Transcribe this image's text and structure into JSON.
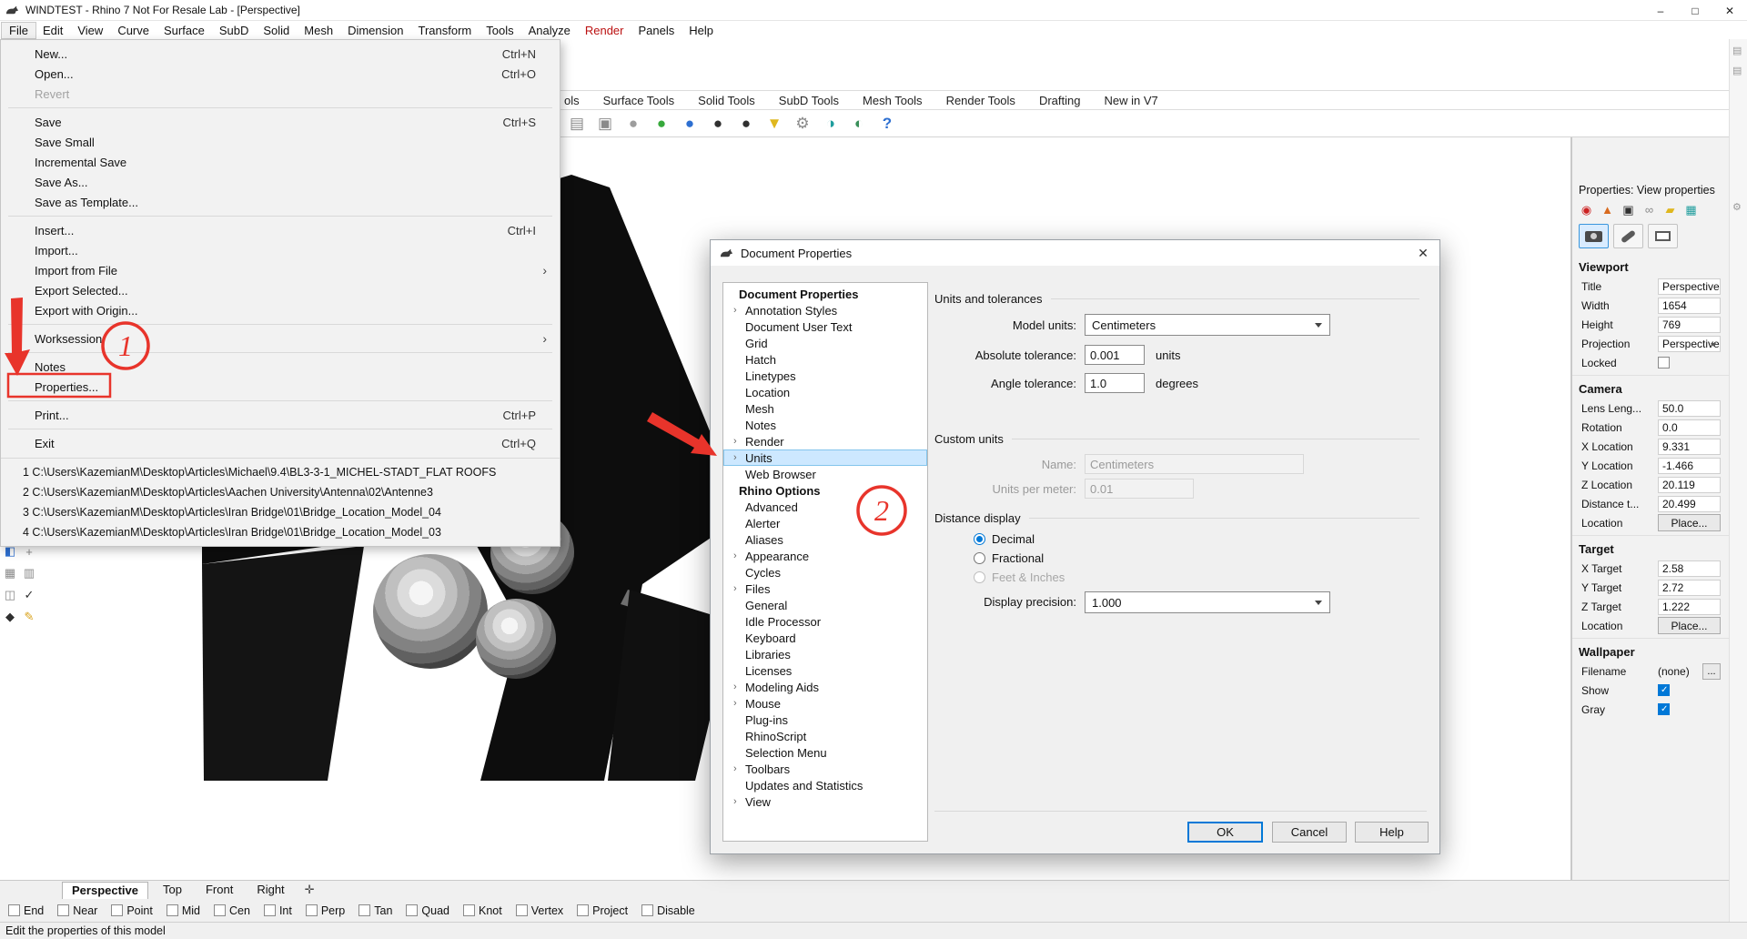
{
  "titlebar": {
    "title": "WINDTEST - Rhino 7 Not For Resale Lab - [Perspective]",
    "controls": {
      "minimize": "–",
      "maximize": "□",
      "close": "✕"
    }
  },
  "menubar": {
    "items": [
      {
        "label": "File",
        "active": true
      },
      {
        "label": "Edit"
      },
      {
        "label": "View"
      },
      {
        "label": "Curve"
      },
      {
        "label": "Surface"
      },
      {
        "label": "SubD"
      },
      {
        "label": "Solid"
      },
      {
        "label": "Mesh"
      },
      {
        "label": "Dimension"
      },
      {
        "label": "Transform"
      },
      {
        "label": "Tools"
      },
      {
        "label": "Analyze"
      },
      {
        "label": "Render",
        "red": true
      },
      {
        "label": "Panels"
      },
      {
        "label": "Help"
      }
    ]
  },
  "file_menu": {
    "items": [
      {
        "label": "New...",
        "shortcut": "Ctrl+N"
      },
      {
        "label": "Open...",
        "shortcut": "Ctrl+O"
      },
      {
        "label": "Revert",
        "disabled": true
      },
      {
        "label": "Save",
        "shortcut": "Ctrl+S",
        "sep_before": true
      },
      {
        "label": "Save Small"
      },
      {
        "label": "Incremental Save"
      },
      {
        "label": "Save As..."
      },
      {
        "label": "Save as Template..."
      },
      {
        "label": "Insert...",
        "shortcut": "Ctrl+I",
        "sep_before": true
      },
      {
        "label": "Import..."
      },
      {
        "label": "Import from File",
        "arrow": "›"
      },
      {
        "label": "Export Selected..."
      },
      {
        "label": "Export with Origin..."
      },
      {
        "label": "Worksession",
        "arrow": "›",
        "sep_before": true
      },
      {
        "label": "Notes",
        "sep_before": true
      },
      {
        "label": "Properties..."
      },
      {
        "label": "Print...",
        "shortcut": "Ctrl+P",
        "sep_before": true
      },
      {
        "label": "Exit",
        "shortcut": "Ctrl+Q",
        "sep_before": true
      }
    ],
    "recent": [
      {
        "label": "1 C:\\Users\\KazemianM\\Desktop\\Articles\\Michael\\9.4\\BL3-3-1_MICHEL-STADT_FLAT ROOFS"
      },
      {
        "label": "2 C:\\Users\\KazemianM\\Desktop\\Articles\\Aachen University\\Antenna\\02\\Antenne3"
      },
      {
        "label": "3 C:\\Users\\KazemianM\\Desktop\\Articles\\Iran Bridge\\01\\Bridge_Location_Model_04"
      },
      {
        "label": "4 C:\\Users\\KazemianM\\Desktop\\Articles\\Iran Bridge\\01\\Bridge_Location_Model_03"
      }
    ]
  },
  "toolbar": {
    "tabs": [
      "ols",
      "Surface Tools",
      "Solid Tools",
      "SubD Tools",
      "Mesh Tools",
      "Render Tools",
      "Drafting",
      "New in V7"
    ],
    "icons": [
      {
        "name": "panel-icon",
        "glyph": "▤",
        "cls": "ic-gray"
      },
      {
        "name": "lock-icon",
        "glyph": "▣",
        "cls": "ic-gray"
      },
      {
        "name": "shaded-sphere-icon",
        "glyph": "●",
        "cls": "ic-midgray"
      },
      {
        "name": "rendered-sphere-icon",
        "glyph": "●",
        "cls": "ic-green"
      },
      {
        "name": "render-icon",
        "glyph": "●",
        "cls": "ic-blue"
      },
      {
        "name": "render-window-icon",
        "glyph": "●",
        "cls": "ic-dark"
      },
      {
        "name": "render-preview-icon",
        "glyph": "●",
        "cls": "ic-dark"
      },
      {
        "name": "filter-icon",
        "glyph": "▼",
        "cls": "ic-yellow"
      },
      {
        "name": "gear-search-icon",
        "glyph": "⚙",
        "cls": "ic-gray"
      },
      {
        "name": "texture-icon",
        "glyph": "◑",
        "cls": "ic-teal"
      },
      {
        "name": "globe-icon",
        "glyph": "◐",
        "cls": "ic-globe"
      },
      {
        "name": "help-icon",
        "glyph": "?",
        "cls": "ic-help"
      }
    ]
  },
  "side_toolbar": {
    "icons": [
      {
        "name": "viewport-layout-icon",
        "glyph": "◧",
        "cls": "ic-blue"
      },
      {
        "name": "osnap-icon",
        "glyph": "+",
        "cls": "ic-gray"
      },
      {
        "name": "grid-icon",
        "glyph": "▦",
        "cls": "ic-gray"
      },
      {
        "name": "layers-icon",
        "glyph": "▥",
        "cls": "ic-gray"
      },
      {
        "name": "panels-icon",
        "glyph": "◫",
        "cls": "ic-gray"
      },
      {
        "name": "check-icon",
        "glyph": "✓",
        "cls": "ic-dark"
      },
      {
        "name": "gem-icon",
        "glyph": "◆",
        "cls": "ic-dark"
      },
      {
        "name": "pencil-icon",
        "glyph": "✎",
        "cls": "ic-yellow2"
      }
    ]
  },
  "dialog": {
    "title": "Document Properties",
    "close_glyph": "✕",
    "tree": [
      {
        "label": "Document Properties",
        "bold": true
      },
      {
        "label": "Annotation Styles",
        "chev": "›"
      },
      {
        "label": "Document User Text"
      },
      {
        "label": "Grid"
      },
      {
        "label": "Hatch"
      },
      {
        "label": "Linetypes"
      },
      {
        "label": "Location"
      },
      {
        "label": "Mesh"
      },
      {
        "label": "Notes"
      },
      {
        "label": "Render",
        "chev": "›"
      },
      {
        "label": "Units",
        "chev": "›",
        "selected": true
      },
      {
        "label": "Web Browser"
      },
      {
        "label": "Rhino Options",
        "bold": true
      },
      {
        "label": "Advanced"
      },
      {
        "label": "Alerter"
      },
      {
        "label": "Aliases"
      },
      {
        "label": "Appearance",
        "chev": "›"
      },
      {
        "label": "Cycles"
      },
      {
        "label": "Files",
        "chev": "›"
      },
      {
        "label": "General"
      },
      {
        "label": "Idle Processor"
      },
      {
        "label": "Keyboard"
      },
      {
        "label": "Libraries"
      },
      {
        "label": "Licenses"
      },
      {
        "label": "Modeling Aids",
        "chev": "›"
      },
      {
        "label": "Mouse",
        "chev": "›"
      },
      {
        "label": "Plug-ins"
      },
      {
        "label": "RhinoScript"
      },
      {
        "label": "Selection Menu"
      },
      {
        "label": "Toolbars",
        "chev": "›"
      },
      {
        "label": "Updates and Statistics"
      },
      {
        "label": "View",
        "chev": "›"
      }
    ],
    "units_group": {
      "title": "Units and tolerances",
      "model_units_label": "Model units:",
      "model_units_value": "Centimeters",
      "abs_tol_label": "Absolute tolerance:",
      "abs_tol_value": "0.001",
      "abs_tol_unit": "units",
      "angle_tol_label": "Angle tolerance:",
      "angle_tol_value": "1.0",
      "angle_tol_unit": "degrees"
    },
    "custom_group": {
      "title": "Custom units",
      "name_label": "Name:",
      "name_value": "Centimeters",
      "upm_label": "Units per meter:",
      "upm_value": "0.01"
    },
    "distance_group": {
      "title": "Distance display",
      "options": [
        {
          "label": "Decimal",
          "checked": true
        },
        {
          "label": "Fractional"
        },
        {
          "label": "Feet & Inches",
          "disabled": true
        }
      ],
      "precision_label": "Display precision:",
      "precision_value": "1.000"
    },
    "buttons": {
      "ok": "OK",
      "cancel": "Cancel",
      "help": "Help"
    }
  },
  "props": {
    "header": "Properties: View properties",
    "tab_icons": [
      {
        "name": "object-properties-icon",
        "glyph": "◉",
        "cls": "ic-red"
      },
      {
        "name": "material-icon",
        "glyph": "▲",
        "cls": "ic-orange"
      },
      {
        "name": "display-icon",
        "glyph": "▣",
        "cls": "ic-dark"
      },
      {
        "name": "link-icon",
        "glyph": "∞",
        "cls": "ic-gray"
      },
      {
        "name": "folder-icon",
        "glyph": "▰",
        "cls": "ic-yellow"
      },
      {
        "name": "image-icon",
        "glyph": "▦",
        "cls": "ic-teal"
      }
    ],
    "viewport": {
      "section": "Viewport",
      "title_label": "Title",
      "title_value": "Perspective",
      "width_label": "Width",
      "width_value": "1654",
      "height_label": "Height",
      "height_value": "769",
      "projection_label": "Projection",
      "projection_value": "Perspective",
      "locked_label": "Locked"
    },
    "camera": {
      "section": "Camera",
      "rows": [
        {
          "label": "Lens Leng...",
          "value": "50.0"
        },
        {
          "label": "Rotation",
          "value": "0.0"
        },
        {
          "label": "X Location",
          "value": "9.331"
        },
        {
          "label": "Y Location",
          "value": "-1.466"
        },
        {
          "label": "Z Location",
          "value": "20.119"
        },
        {
          "label": "Distance t...",
          "value": "20.499"
        }
      ],
      "location_label": "Location",
      "place_button": "Place..."
    },
    "target": {
      "section": "Target",
      "rows": [
        {
          "label": "X Target",
          "value": "2.58"
        },
        {
          "label": "Y Target",
          "value": "2.72"
        },
        {
          "label": "Z Target",
          "value": "1.222"
        }
      ],
      "location_label": "Location",
      "place_button": "Place..."
    },
    "wallpaper": {
      "section": "Wallpaper",
      "filename_label": "Filename",
      "filename_value": "(none)",
      "browse_label": "...",
      "show_label": "Show",
      "gray_label": "Gray"
    }
  },
  "viewport_area": {
    "tabs": [
      {
        "label": "Perspective",
        "active": true
      },
      {
        "label": "Top"
      },
      {
        "label": "Front"
      },
      {
        "label": "Right"
      }
    ],
    "plus_glyph": "✛"
  },
  "osnap": {
    "items": [
      "End",
      "Near",
      "Point",
      "Mid",
      "Cen",
      "Int",
      "Perp",
      "Tan",
      "Quad",
      "Knot",
      "Vertex",
      "Project",
      "Disable"
    ]
  },
  "statusbar": {
    "text": "Edit the properties of this model"
  },
  "annotations": {
    "one": "1",
    "two": "2"
  }
}
